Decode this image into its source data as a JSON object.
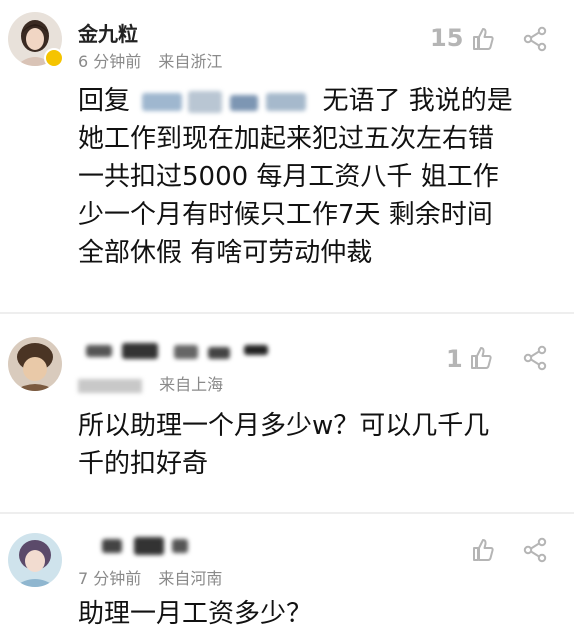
{
  "comments": [
    {
      "username": "金九粒",
      "time": "6 分钟前",
      "location": "来自浙江",
      "likes": "15",
      "lines": [
        "回复",
        "无语了 我说的是",
        "她工作到现在加起来犯过五次左右错",
        "一共扣过5000 每月工资八千 姐工作",
        "少一个月有时候只工作7天 剩余时间",
        "全部休假 有啥可劳动仲裁"
      ]
    },
    {
      "username": "",
      "time": "",
      "location": "来自上海",
      "likes": "1",
      "lines": [
        "所以助理一个月多少w？可以几千几",
        "千的扣好奇"
      ]
    },
    {
      "username": "",
      "time": "7 分钟前",
      "location": "来自河南",
      "likes": "",
      "lines": [
        "助理一月工资多少？"
      ]
    }
  ],
  "icons": {
    "like": "thumbs-up-icon",
    "share": "share-icon"
  },
  "colors": {
    "meta": "#8a8a8a",
    "icon": "#b5b5b5",
    "badge": "#f5c400"
  }
}
